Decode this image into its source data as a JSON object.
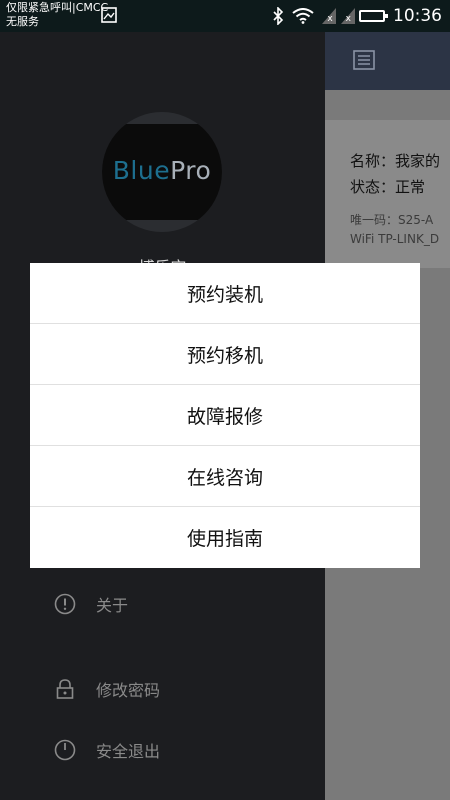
{
  "status_bar": {
    "carrier_line1": "仅限紧急呼叫|CMCC",
    "carrier_line2": "无服务",
    "sim1": "x",
    "sim2": "x",
    "time": "10:36"
  },
  "main": {
    "card": {
      "name": "名称：我家的",
      "status": "状态：正常",
      "uid": "唯一码：S25-A",
      "wifi": "WiFi TP-LINK_D"
    }
  },
  "drawer": {
    "logo": {
      "part1": "Blue",
      "part2": "Pro"
    },
    "username": "博乐宝",
    "menu": [
      {
        "label": "关于",
        "icon": "info-icon"
      },
      {
        "label": "修改密码",
        "icon": "lock-icon"
      },
      {
        "label": "安全退出",
        "icon": "power-icon"
      }
    ]
  },
  "dialog": {
    "options": [
      "预约装机",
      "预约移机",
      "故障报修",
      "在线咨询",
      "使用指南"
    ]
  },
  "colors": {
    "status_bar": "#0d1a1b",
    "drawer_bg": "#1c1d20",
    "main_header": "#2c3445",
    "logo_blue": "#1d6f8f"
  }
}
